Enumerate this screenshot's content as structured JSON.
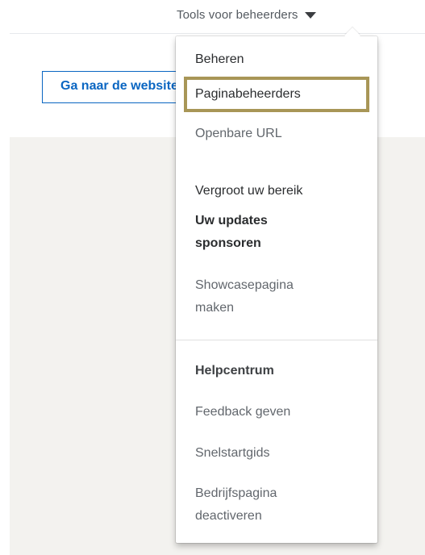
{
  "header": {
    "tools_label": "Tools voor beheerders"
  },
  "page": {
    "goto_button_label": "Ga naar de website"
  },
  "menu": {
    "beheren_heading": "Beheren",
    "paginabeheerders": "Paginabeheerders",
    "openbare_url": "Openbare URL",
    "bereik_heading": "Vergroot uw bereik",
    "updates_line1": "Uw updates",
    "updates_line2": "sponsoren",
    "showcase_line1": "Showcasepagina",
    "showcase_line2": "maken",
    "helpcentrum": "Helpcentrum",
    "feedback": "Feedback geven",
    "snelstart": "Snelstartgids",
    "deactiveren_line1": "Bedrijfspagina",
    "deactiveren_line2": "deactiveren"
  },
  "colors": {
    "highlight_border": "#a89657",
    "link_blue": "#0a66c2",
    "gray_background": "#f3f2ef"
  }
}
